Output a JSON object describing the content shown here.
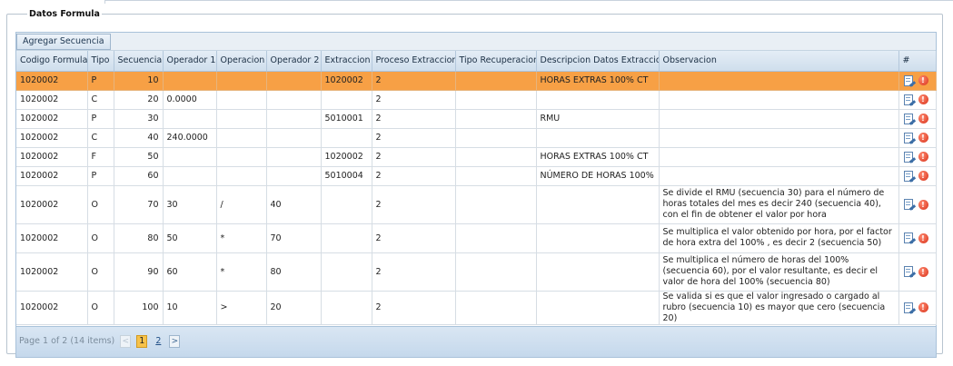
{
  "legend": "Datos Formula",
  "toolbar": {
    "add_label": "Agregar Secuencia"
  },
  "columns": [
    "Codigo Formula",
    "Tipo",
    "Secuencia",
    "Operador 1",
    "Operacion",
    "Operador 2",
    "Extraccion",
    "Proceso Extraccion",
    "Tipo Recuperacion",
    "Descripcion Datos Extraccion",
    "Observacion",
    "#"
  ],
  "rows": [
    {
      "codigo": "1020002",
      "tipo": "P",
      "secuencia": "10",
      "op1": "",
      "operacion": "",
      "op2": "",
      "extraccion": "1020002",
      "proceso": "2",
      "tiporec": "",
      "descripcion": "HORAS EXTRAS 100% CT",
      "observacion": ""
    },
    {
      "codigo": "1020002",
      "tipo": "C",
      "secuencia": "20",
      "op1": "0.0000",
      "operacion": "",
      "op2": "",
      "extraccion": "",
      "proceso": "2",
      "tiporec": "",
      "descripcion": "",
      "observacion": ""
    },
    {
      "codigo": "1020002",
      "tipo": "P",
      "secuencia": "30",
      "op1": "",
      "operacion": "",
      "op2": "",
      "extraccion": "5010001",
      "proceso": "2",
      "tiporec": "",
      "descripcion": "RMU",
      "observacion": ""
    },
    {
      "codigo": "1020002",
      "tipo": "C",
      "secuencia": "40",
      "op1": "240.0000",
      "operacion": "",
      "op2": "",
      "extraccion": "",
      "proceso": "2",
      "tiporec": "",
      "descripcion": "",
      "observacion": ""
    },
    {
      "codigo": "1020002",
      "tipo": "F",
      "secuencia": "50",
      "op1": "",
      "operacion": "",
      "op2": "",
      "extraccion": "1020002",
      "proceso": "2",
      "tiporec": "",
      "descripcion": "HORAS EXTRAS 100% CT",
      "observacion": ""
    },
    {
      "codigo": "1020002",
      "tipo": "P",
      "secuencia": "60",
      "op1": "",
      "operacion": "",
      "op2": "",
      "extraccion": "5010004",
      "proceso": "2",
      "tiporec": "",
      "descripcion": "NÚMERO DE HORAS 100%",
      "observacion": ""
    },
    {
      "codigo": "1020002",
      "tipo": "O",
      "secuencia": "70",
      "op1": "30",
      "operacion": "/",
      "op2": "40",
      "extraccion": "",
      "proceso": "2",
      "tiporec": "",
      "descripcion": "",
      "observacion": "Se divide el RMU (secuencia 30) para el número de horas totales del mes es decir 240 (secuencia 40), con el fin de obtener el valor por hora"
    },
    {
      "codigo": "1020002",
      "tipo": "O",
      "secuencia": "80",
      "op1": "50",
      "operacion": "*",
      "op2": "70",
      "extraccion": "",
      "proceso": "2",
      "tiporec": "",
      "descripcion": "",
      "observacion": "Se multiplica el valor obtenido por hora, por el factor de hora extra del 100% , es decir 2 (secuencia 50)"
    },
    {
      "codigo": "1020002",
      "tipo": "O",
      "secuencia": "90",
      "op1": "60",
      "operacion": "*",
      "op2": "80",
      "extraccion": "",
      "proceso": "2",
      "tiporec": "",
      "descripcion": "",
      "observacion": "Se multiplica el número de horas del 100% (secuencia 60), por el valor resultante, es decir el valor de hora del 100% (secuencia 80)"
    },
    {
      "codigo": "1020002",
      "tipo": "O",
      "secuencia": "100",
      "op1": "10",
      "operacion": ">",
      "op2": "20",
      "extraccion": "",
      "proceso": "2",
      "tiporec": "",
      "descripcion": "",
      "observacion": "Se valida si es que el valor ingresado o cargado al rubro (secuencia 10) es mayor que cero (secuencia 20)"
    }
  ],
  "pager": {
    "info": "Page 1 of 2 (14 items)",
    "prev_glyph": "<",
    "next_glyph": ">",
    "pages": [
      "1",
      "2"
    ],
    "current": "1"
  },
  "icons": {
    "edit": "edit-document-icon",
    "delete": "delete-icon",
    "delete_glyph": "!"
  },
  "colors": {
    "selected_row": "#f7a045",
    "header": "#cfdeec",
    "pager": "#c5d8ec"
  }
}
